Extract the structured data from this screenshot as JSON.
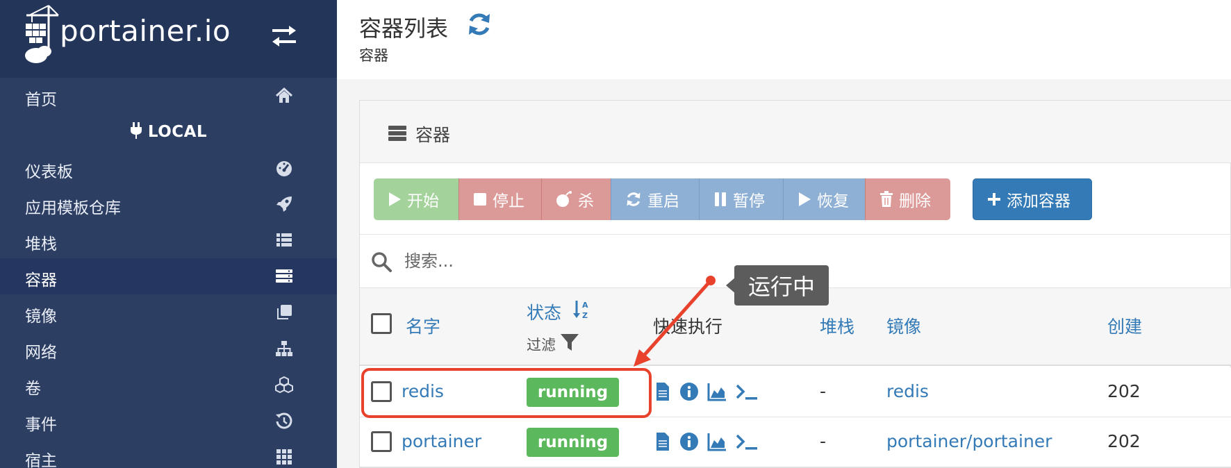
{
  "brand": {
    "logo_text": "portainer.io"
  },
  "sidebar": {
    "items": [
      {
        "label": "首页",
        "icon": "home-icon"
      },
      {
        "label": "仪表板",
        "icon": "tachometer-icon"
      },
      {
        "label": "应用模板仓库",
        "icon": "rocket-icon"
      },
      {
        "label": "堆栈",
        "icon": "list-icon"
      },
      {
        "label": "容器",
        "icon": "server-icon",
        "active": true
      },
      {
        "label": "镜像",
        "icon": "clone-icon"
      },
      {
        "label": "网络",
        "icon": "sitemap-icon"
      },
      {
        "label": "卷",
        "icon": "cubes-icon"
      },
      {
        "label": "事件",
        "icon": "history-icon"
      },
      {
        "label": "宿主",
        "icon": "grid-icon"
      }
    ],
    "environment": "LOCAL"
  },
  "header": {
    "title": "容器列表",
    "breadcrumb": "容器"
  },
  "panel": {
    "title": "容器"
  },
  "toolbar": {
    "start": "开始",
    "stop": "停止",
    "kill": "杀",
    "restart": "重启",
    "pause": "暂停",
    "resume": "恢复",
    "remove": "删除",
    "add": "添加容器"
  },
  "search": {
    "placeholder": "搜索..."
  },
  "table": {
    "columns": {
      "name": "名字",
      "state": "状态",
      "state_filter": "过滤",
      "quick_actions": "快速执行",
      "stack": "堆栈",
      "image": "镜像",
      "created": "创建"
    },
    "rows": [
      {
        "name": "redis",
        "state": "running",
        "stack": "-",
        "image": "redis",
        "created": "202"
      },
      {
        "name": "portainer",
        "state": "running",
        "stack": "-",
        "image": "portainer/portainer",
        "created": "202"
      }
    ]
  },
  "annotation": {
    "tooltip": "运行中"
  },
  "colors": {
    "sidebar": "#2d3e63",
    "primary": "#337ab7",
    "running": "#5cb85c",
    "annotation": "#e8412c"
  }
}
